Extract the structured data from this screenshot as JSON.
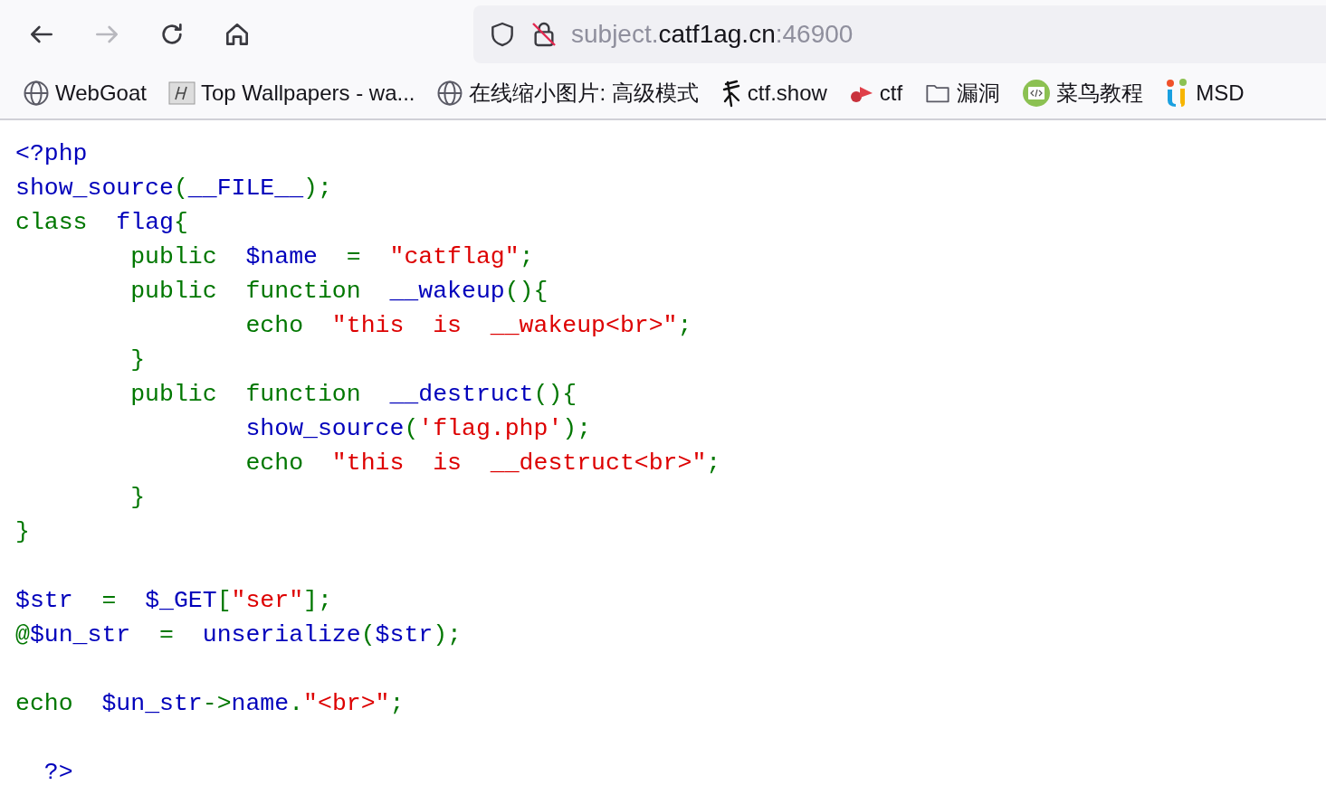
{
  "toolbar": {
    "buttons": [
      {
        "kind": "back",
        "disabled": false
      },
      {
        "kind": "forward",
        "disabled": true
      },
      {
        "kind": "reload",
        "disabled": false
      },
      {
        "kind": "home",
        "disabled": false
      }
    ],
    "url": [
      {
        "text": "subject.",
        "kind": "dim"
      },
      {
        "text": "catf1ag.cn",
        "kind": "host"
      },
      {
        "text": ":46900",
        "kind": "dim"
      }
    ]
  },
  "bookmarks": [
    {
      "label": "WebGoat",
      "kind": "globe"
    },
    {
      "label": "Top Wallpapers - wa...",
      "kind": "tile"
    },
    {
      "label": "在线缩小图片: 高级模式",
      "kind": "globe"
    },
    {
      "label": "ctf.show",
      "kind": "figure"
    },
    {
      "label": "ctf",
      "kind": "flag"
    },
    {
      "label": "漏洞",
      "kind": "folder"
    },
    {
      "label": "菜鸟教程",
      "kind": "code"
    },
    {
      "label": "MSD",
      "kind": "letters"
    }
  ],
  "source": [
    {
      "gap_before": false,
      "tokens": [
        {
          "t": "<?php",
          "kind": "default"
        }
      ]
    },
    {
      "gap_before": false,
      "tokens": [
        {
          "t": "show_source",
          "kind": "default"
        },
        {
          "t": "(",
          "kind": "keyword"
        },
        {
          "t": "__FILE__",
          "kind": "default"
        },
        {
          "t": ");",
          "kind": "keyword"
        }
      ]
    },
    {
      "gap_before": false,
      "tokens": [
        {
          "t": "class  ",
          "kind": "keyword"
        },
        {
          "t": "flag",
          "kind": "default"
        },
        {
          "t": "{",
          "kind": "keyword"
        }
      ]
    },
    {
      "gap_before": false,
      "tokens": [
        {
          "t": "        public  ",
          "kind": "keyword"
        },
        {
          "t": "$name  ",
          "kind": "default"
        },
        {
          "t": "=  ",
          "kind": "keyword"
        },
        {
          "t": "\"catflag\"",
          "kind": "string"
        },
        {
          "t": ";",
          "kind": "keyword"
        }
      ]
    },
    {
      "gap_before": false,
      "tokens": [
        {
          "t": "        public  function  ",
          "kind": "keyword"
        },
        {
          "t": "__wakeup",
          "kind": "default"
        },
        {
          "t": "(){",
          "kind": "keyword"
        }
      ]
    },
    {
      "gap_before": false,
      "tokens": [
        {
          "t": "                echo  ",
          "kind": "keyword"
        },
        {
          "t": "\"this  is  __wakeup<br>\"",
          "kind": "string"
        },
        {
          "t": ";",
          "kind": "keyword"
        }
      ]
    },
    {
      "gap_before": false,
      "tokens": [
        {
          "t": "        }",
          "kind": "keyword"
        }
      ]
    },
    {
      "gap_before": false,
      "tokens": [
        {
          "t": "        public  function  ",
          "kind": "keyword"
        },
        {
          "t": "__destruct",
          "kind": "default"
        },
        {
          "t": "(){",
          "kind": "keyword"
        }
      ]
    },
    {
      "gap_before": false,
      "tokens": [
        {
          "t": "                show_source",
          "kind": "default"
        },
        {
          "t": "(",
          "kind": "keyword"
        },
        {
          "t": "'flag.php'",
          "kind": "string"
        },
        {
          "t": ");",
          "kind": "keyword"
        }
      ]
    },
    {
      "gap_before": false,
      "tokens": [
        {
          "t": "                echo  ",
          "kind": "keyword"
        },
        {
          "t": "\"this  is  __destruct<br>\"",
          "kind": "string"
        },
        {
          "t": ";",
          "kind": "keyword"
        }
      ]
    },
    {
      "gap_before": false,
      "tokens": [
        {
          "t": "        }",
          "kind": "keyword"
        }
      ]
    },
    {
      "gap_before": false,
      "tokens": [
        {
          "t": "}",
          "kind": "keyword"
        }
      ]
    },
    {
      "gap_before": true,
      "tokens": [
        {
          "t": "$str  ",
          "kind": "default"
        },
        {
          "t": "=  ",
          "kind": "keyword"
        },
        {
          "t": "$_GET",
          "kind": "default"
        },
        {
          "t": "[",
          "kind": "keyword"
        },
        {
          "t": "\"ser\"",
          "kind": "string"
        },
        {
          "t": "];",
          "kind": "keyword"
        }
      ]
    },
    {
      "gap_before": false,
      "tokens": [
        {
          "t": "@",
          "kind": "keyword"
        },
        {
          "t": "$un_str  ",
          "kind": "default"
        },
        {
          "t": "=  ",
          "kind": "keyword"
        },
        {
          "t": "unserialize",
          "kind": "default"
        },
        {
          "t": "(",
          "kind": "keyword"
        },
        {
          "t": "$str",
          "kind": "default"
        },
        {
          "t": ");",
          "kind": "keyword"
        }
      ]
    },
    {
      "gap_before": true,
      "tokens": [
        {
          "t": "echo  ",
          "kind": "keyword"
        },
        {
          "t": "$un_str",
          "kind": "default"
        },
        {
          "t": "->",
          "kind": "keyword"
        },
        {
          "t": "name",
          "kind": "default"
        },
        {
          "t": ".",
          "kind": "keyword"
        },
        {
          "t": "\"<br>\"",
          "kind": "string"
        },
        {
          "t": ";",
          "kind": "keyword"
        }
      ]
    },
    {
      "gap_before": true,
      "tokens": [
        {
          "t": "  ?>",
          "kind": "default"
        }
      ]
    }
  ]
}
